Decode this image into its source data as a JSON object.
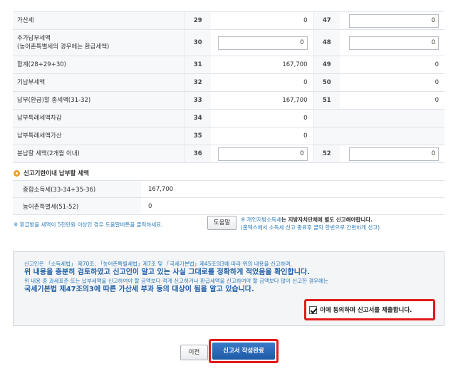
{
  "tax_rows": [
    {
      "label": "가산세",
      "num_a": "29",
      "val_a": "0",
      "num_b": "47",
      "val_b": "0"
    },
    {
      "label": "추가납부세액",
      "label2": "(농어촌특별세의 경우에는 환급세액)",
      "num_a": "30",
      "val_a": "0",
      "num_b": "48",
      "val_b": "0"
    },
    {
      "label": "합계(28+29+30)",
      "num_a": "31",
      "val_a": "167,700",
      "num_b": "49",
      "val_b": "0"
    },
    {
      "label": "기납부세액",
      "num_a": "32",
      "val_a": "0",
      "num_b": "50",
      "val_b": "0"
    },
    {
      "label": "납부(환급)할 총세액(31-32)",
      "num_a": "33",
      "val_a": "167,700",
      "num_b": "51",
      "val_b": "0"
    },
    {
      "label": "납부특례세액차감",
      "num_a": "34",
      "val_a": "0"
    },
    {
      "label": "납부특례세액가산",
      "num_a": "35",
      "val_a": "0"
    },
    {
      "label": "분납할 세액(2개월 이내)",
      "num_a": "36",
      "val_a": "0",
      "num_b": "52",
      "val_b": "0"
    }
  ],
  "summary": {
    "heading": "신고기한이내 납부할 세액",
    "rows": [
      {
        "label": "종합소득세(33-34+35-36)",
        "value": "167,700"
      },
      {
        "label": "농어촌특별세(51-52)",
        "value": "0"
      }
    ]
  },
  "help": {
    "note_left": "※ 환급받을 세액이 5천만원 이상인 경우 도움말버튼을 클릭하세요.",
    "button_label": "도움말",
    "note_right_prefix": "※ 개인지방소득세",
    "note_right_bold": "는 지방자치단체에 별도 신고해야합니다.",
    "note_right_line2": "(홈택스에서 소득세 신고 종료후 클릭 한번으로 간편하게 신고)"
  },
  "declaration": {
    "line1": "신고인은 「소득세법」 제70조, 「농어촌특별세법」제7조 및 「국세기본법」제45조의3에 따라 위의 내용을 신고하며,",
    "line2": "위 내용을 충분히 검토하였고 신고인이 알고 있는 사실 그대로를 정확하게 적었음을 확인합니다.",
    "line3": "위 내용 중 과세표준 또는 납부세액을 신고하여야 할 금액보다 적게 신고하거나 환급세액을 신고하여야 할 금액보다 많이 신고한 경우에는",
    "line4": "국세기본법 제47조의3에 따른 가산세 부과 등의 대상이 됨을 알고 있습니다.",
    "agree_label": "이에 동의하며 신고서를 제출합니다."
  },
  "buttons": {
    "prev": "이전",
    "submit": "신고서 작성완료"
  },
  "colors": {
    "accent_blue": "#1f5fa8",
    "note_blue": "#2a7ab8",
    "highlight_red": "#e21a1a",
    "bullet_orange": "#f0a020"
  }
}
